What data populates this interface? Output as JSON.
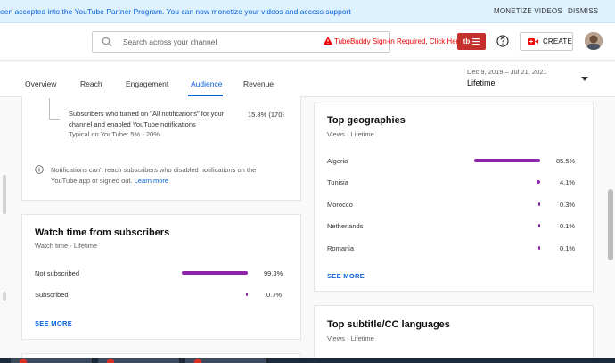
{
  "banner": {
    "message": "een accepted into the YouTube Partner Program. You can now monetize your videos and access support",
    "monetize_label": "MONETIZE VIDEOS",
    "dismiss_label": "DISMISS"
  },
  "topbar": {
    "search_placeholder": "Search across your channel",
    "tubebuddy_warning": "TubeBuddy Sign-in Required, Click Here",
    "tubebuddy_logo": "tb",
    "create_label": "CREATE"
  },
  "tabs": [
    {
      "label": "Overview"
    },
    {
      "label": "Reach"
    },
    {
      "label": "Engagement"
    },
    {
      "label": "Audience"
    },
    {
      "label": "Revenue"
    }
  ],
  "date": {
    "range": "Dec 9, 2019 – Jul 21, 2021",
    "period": "Lifetime"
  },
  "notifications": {
    "text": "Subscribers who turned on \"All notifications\" for your channel and enabled YouTube notifications",
    "typical": "Typical on YouTube: 5% - 20%",
    "value": "15.8% (170)",
    "info_text": "Notifications can't reach subscribers who disabled notifications on the YouTube app or signed out.",
    "learn_more": "Learn more"
  },
  "watch_time": {
    "title": "Watch time from subscribers",
    "subtitle": "Watch time · Lifetime",
    "rows": [
      {
        "label": "Not subscribed",
        "value": "99.3%",
        "fraction": 0.993
      },
      {
        "label": "Subscribed",
        "value": "0.7%",
        "fraction": 0.007
      }
    ],
    "see_more": "SEE MORE"
  },
  "geographies": {
    "title": "Top geographies",
    "subtitle": "Views · Lifetime",
    "rows": [
      {
        "label": "Algeria",
        "value": "85.5%",
        "fraction": 0.855
      },
      {
        "label": "Tunisia",
        "value": "4.1%",
        "fraction": 0.041
      },
      {
        "label": "Morocco",
        "value": "0.3%",
        "fraction": 0.003
      },
      {
        "label": "Netherlands",
        "value": "0.1%",
        "fraction": 0.001
      },
      {
        "label": "Romania",
        "value": "0.1%",
        "fraction": 0.001
      }
    ],
    "see_more": "SEE MORE"
  },
  "subtitles": {
    "title": "Top subtitle/CC languages",
    "subtitle": "Views · Lifetime"
  },
  "colors": {
    "accent": "#065fd4",
    "bar": "#8e24aa",
    "warning": "#e00000"
  }
}
